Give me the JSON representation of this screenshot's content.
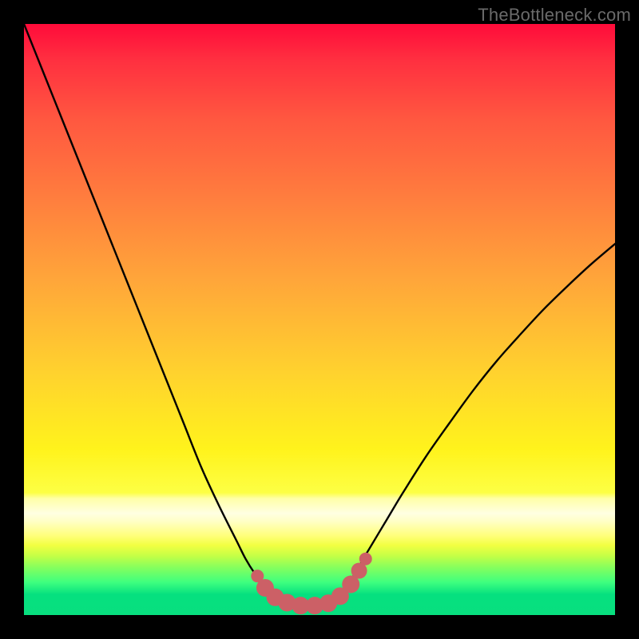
{
  "watermark": "TheBottleneck.com",
  "chart_data": {
    "type": "line",
    "title": "",
    "xlabel": "",
    "ylabel": "",
    "x_range": [
      0,
      1
    ],
    "y_range": [
      0,
      1
    ],
    "series": [
      {
        "name": "bottleneck-curve",
        "stroke": "#000000",
        "x": [
          0.0,
          0.03,
          0.06,
          0.09,
          0.12,
          0.15,
          0.18,
          0.21,
          0.24,
          0.27,
          0.3,
          0.33,
          0.36,
          0.375,
          0.39,
          0.405,
          0.42,
          0.435,
          0.45,
          0.465,
          0.48,
          0.495,
          0.51,
          0.525,
          0.54,
          0.56,
          0.58,
          0.61,
          0.64,
          0.68,
          0.72,
          0.76,
          0.8,
          0.84,
          0.88,
          0.92,
          0.96,
          1.0
        ],
        "y": [
          1.0,
          0.925,
          0.85,
          0.775,
          0.7,
          0.625,
          0.55,
          0.475,
          0.4,
          0.325,
          0.25,
          0.185,
          0.125,
          0.095,
          0.071,
          0.052,
          0.038,
          0.028,
          0.021,
          0.017,
          0.015,
          0.015,
          0.018,
          0.025,
          0.04,
          0.07,
          0.105,
          0.155,
          0.205,
          0.268,
          0.325,
          0.38,
          0.43,
          0.475,
          0.518,
          0.557,
          0.594,
          0.628
        ]
      }
    ],
    "markers": {
      "name": "trough-markers",
      "fill": "#cc6066",
      "points": [
        {
          "x": 0.395,
          "y": 0.066,
          "r": 8
        },
        {
          "x": 0.408,
          "y": 0.046,
          "r": 11
        },
        {
          "x": 0.425,
          "y": 0.03,
          "r": 11
        },
        {
          "x": 0.445,
          "y": 0.021,
          "r": 11
        },
        {
          "x": 0.468,
          "y": 0.016,
          "r": 11
        },
        {
          "x": 0.492,
          "y": 0.016,
          "r": 11
        },
        {
          "x": 0.515,
          "y": 0.02,
          "r": 11
        },
        {
          "x": 0.535,
          "y": 0.032,
          "r": 11
        },
        {
          "x": 0.553,
          "y": 0.052,
          "r": 11
        },
        {
          "x": 0.567,
          "y": 0.075,
          "r": 10
        },
        {
          "x": 0.578,
          "y": 0.095,
          "r": 8
        }
      ]
    }
  }
}
